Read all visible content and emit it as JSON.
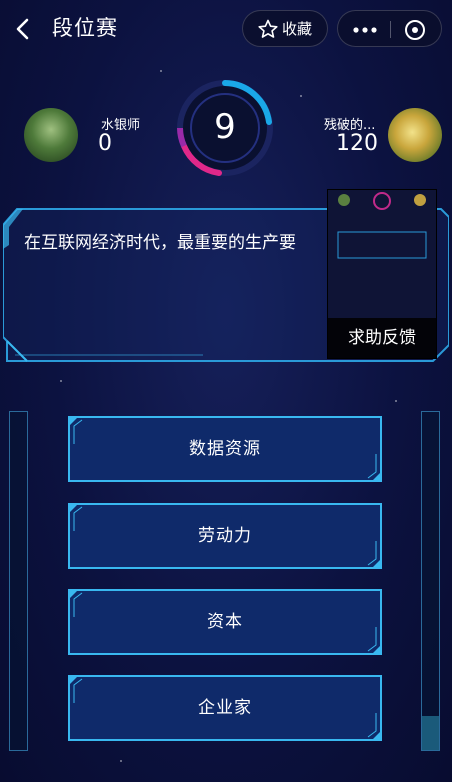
{
  "topbar": {
    "title": "段位赛",
    "favorite_label": "收藏",
    "icons": [
      "back-arrow-icon",
      "star-icon",
      "more-dots-icon",
      "close-target-icon"
    ]
  },
  "players": {
    "left": {
      "name": "水银师",
      "score": "0"
    },
    "right": {
      "name": "残破的...",
      "score": "120"
    }
  },
  "timer": {
    "seconds": "9",
    "ring_colors": [
      "#1aa8e8",
      "#e0288a"
    ]
  },
  "question": {
    "text": "在互联网经济时代，最重要的生产要"
  },
  "help_popup": {
    "label": "求助反馈"
  },
  "options": [
    {
      "label": "数据资源"
    },
    {
      "label": "劳动力"
    },
    {
      "label": "资本"
    },
    {
      "label": "企业家"
    }
  ],
  "colors": {
    "accent": "#39b8f0",
    "panel_border": "#2a9ad8",
    "background": "#0c1240"
  }
}
